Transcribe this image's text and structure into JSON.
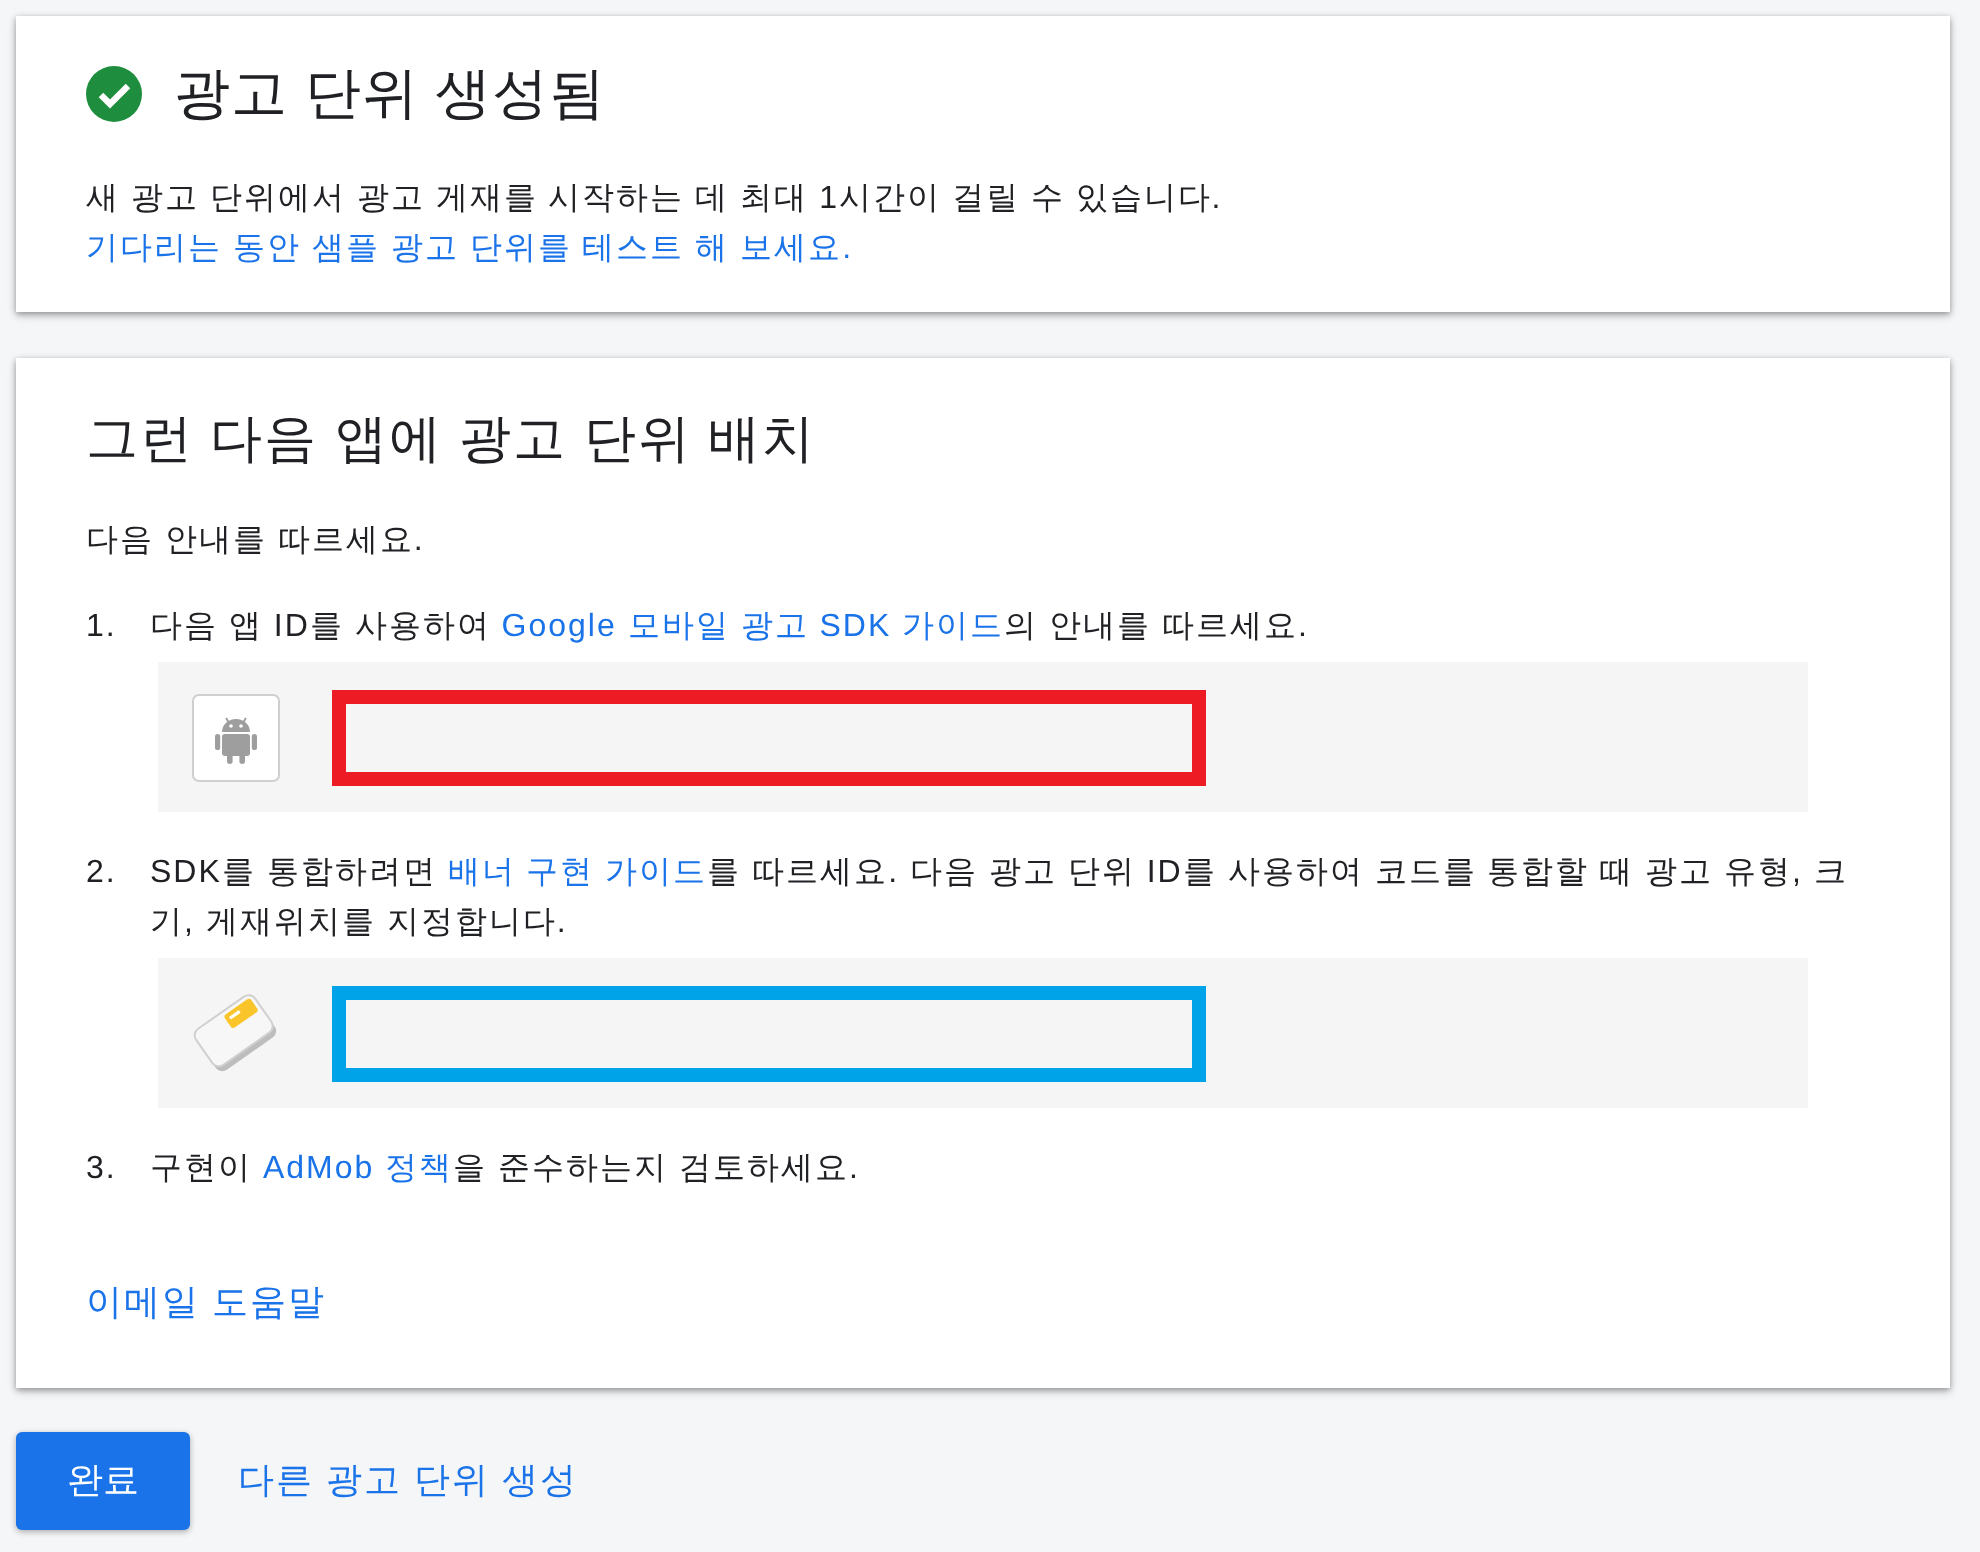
{
  "success_card": {
    "title": "광고 단위 생성됨",
    "message": [
      {
        "kind": "text",
        "text": "새 광고 단위에서 광고 게재를 시작하는 데 최대 1시간이 걸릴 수 있습니다. "
      },
      {
        "kind": "link",
        "text": "기다리는 동안 샘플 광고 단위를 테스트 해 보세요."
      }
    ]
  },
  "placement_card": {
    "title": "그런 다음 앱에 광고 단위 배치",
    "intro": "다음 안내를 따르세요.",
    "steps": [
      {
        "number": "1.",
        "parts": [
          {
            "kind": "text",
            "text": "다음 앱 ID를 사용하여 "
          },
          {
            "kind": "link",
            "text": "Google 모바일 광고 SDK 가이드"
          },
          {
            "kind": "text",
            "text": "의 안내를 따르세요."
          }
        ],
        "id_panel": {
          "kind": "app",
          "color": "#ed1c24"
        }
      },
      {
        "number": "2.",
        "parts": [
          {
            "kind": "text",
            "text": "SDK를 통합하려면 "
          },
          {
            "kind": "link",
            "text": "배너 구현 가이드"
          },
          {
            "kind": "text",
            "text": "를 따르세요. 다음 광고 단위 ID를 사용하여 코드를 통합할 때 광고 유형, 크기, 게재위치를 지정합니다."
          }
        ],
        "id_panel": {
          "kind": "unit",
          "color": "#00a2e8"
        }
      },
      {
        "number": "3.",
        "parts": [
          {
            "kind": "text",
            "text": "구현이 "
          },
          {
            "kind": "link",
            "text": "AdMob 정책"
          },
          {
            "kind": "text",
            "text": "을 준수하는지 검토하세요."
          }
        ]
      }
    ],
    "help_link": "이메일 도움말"
  },
  "actions": {
    "done_button": "완료",
    "create_another_link": "다른 광고 단위 생성"
  }
}
